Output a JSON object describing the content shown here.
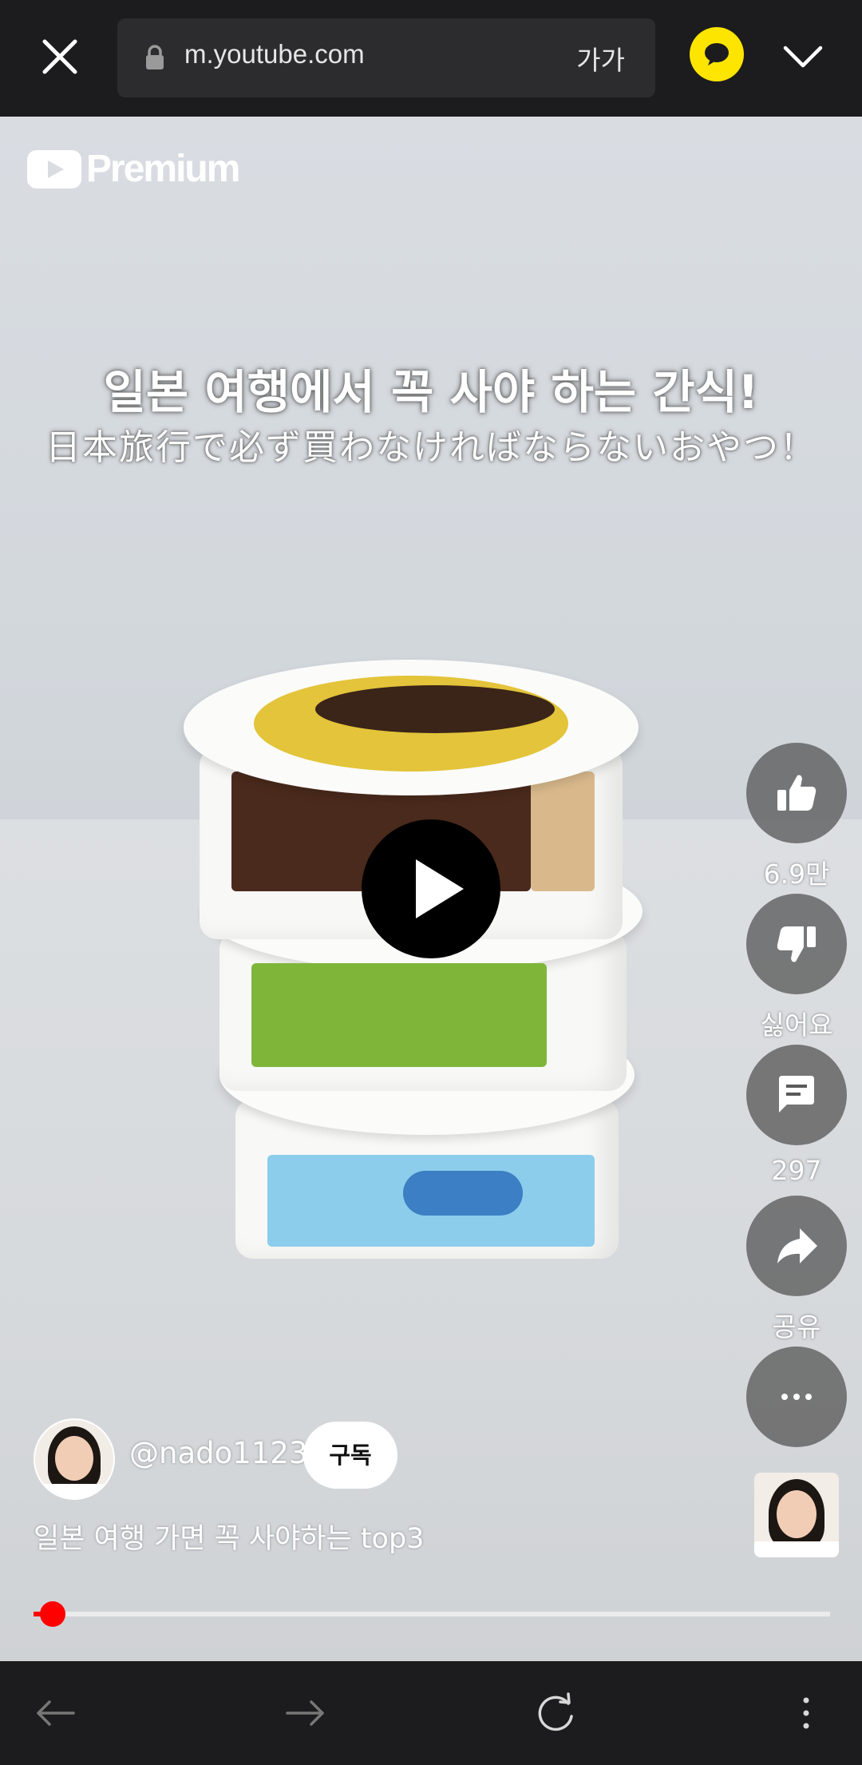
{
  "browser": {
    "url": "m.youtube.com",
    "font_size_label": "가가",
    "icons": [
      "close-icon",
      "lock-icon",
      "kakao-talk-icon",
      "chevron-down-icon"
    ]
  },
  "video": {
    "brand": "Premium",
    "caption_korean": "일본 여행에서 꼭 사야 하는 간식!",
    "caption_japanese": "日本旅行で必ず買わなければならないおやつ！",
    "actions": {
      "like_count": "6.9만",
      "dislike_label": "싫어요",
      "comment_count": "297",
      "share_label": "공유"
    },
    "channel_handle": "@nado1123",
    "subscribe_label": "구독",
    "title": "일본 여행 가면 꼭 사야하는 top3",
    "progress": 0.024
  },
  "nav": {
    "icons": [
      "back-arrow-icon",
      "forward-arrow-icon",
      "reload-icon",
      "more-vertical-icon"
    ]
  },
  "colors": {
    "bar_background": "#1c1c1e",
    "kakao_yellow": "#fee500",
    "progress_red": "#ff0000"
  }
}
